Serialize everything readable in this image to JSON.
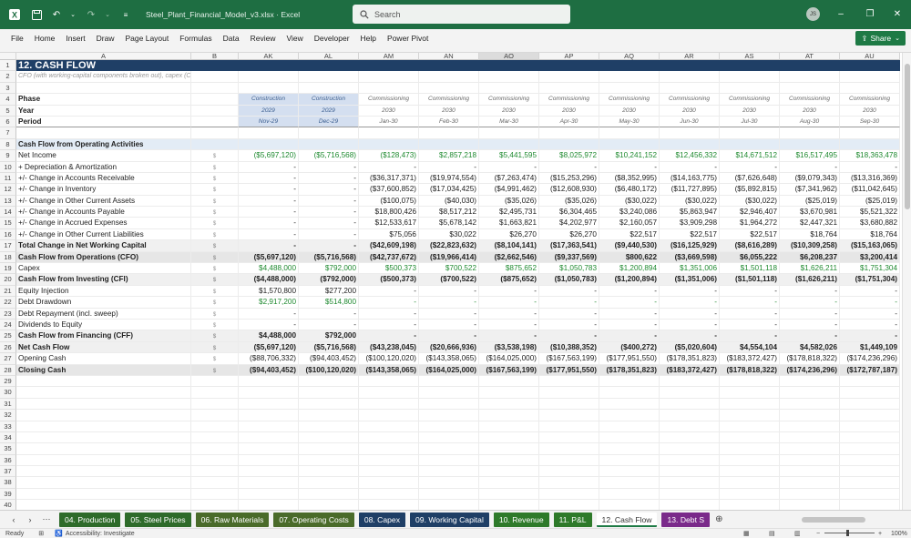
{
  "window": {
    "file_name": "Steel_Plant_Financial_Model_v3.xlsx",
    "app_name": "Excel",
    "search_placeholder": "Search",
    "user_initials": "JS",
    "theme_color": "#1e6e42"
  },
  "menu": [
    "File",
    "Home",
    "Insert",
    "Draw",
    "Page Layout",
    "Formulas",
    "Data",
    "Review",
    "View",
    "Developer",
    "Help",
    "Power Pivot"
  ],
  "share_label": "Share",
  "columns": [
    "A",
    "B",
    "AK",
    "AL",
    "AM",
    "AN",
    "AO",
    "AP",
    "AQ",
    "AR",
    "AS",
    "AT",
    "AU"
  ],
  "selected_column": "AO",
  "rows": [
    {
      "n": "1",
      "type": "title",
      "label": "12. CASH FLOW",
      "values": []
    },
    {
      "n": "2",
      "type": "sub",
      "label": "CFO (with working-capital components broken out), capex (CFI), financ",
      "values": []
    },
    {
      "n": "3",
      "type": "blank",
      "label": "",
      "values": []
    },
    {
      "n": "4",
      "type": "hdr",
      "label": "Phase",
      "values": [
        "Construction",
        "Construction",
        "Commissioning",
        "Commissioning",
        "Commissioning",
        "Commissioning",
        "Commissioning",
        "Commissioning",
        "Commissioning",
        "Commissioning",
        "Commissioning"
      ]
    },
    {
      "n": "5",
      "type": "hdr",
      "label": "Year",
      "values": [
        "2029",
        "2029",
        "2030",
        "2030",
        "2030",
        "2030",
        "2030",
        "2030",
        "2030",
        "2030",
        "2030"
      ]
    },
    {
      "n": "6",
      "type": "hdr",
      "label": "Period",
      "values": [
        "Nov-29",
        "Dec-29",
        "Jan-30",
        "Feb-30",
        "Mar-30",
        "Apr-30",
        "May-30",
        "Jun-30",
        "Jul-30",
        "Aug-30",
        "Sep-30"
      ]
    },
    {
      "n": "7",
      "type": "blank",
      "label": "",
      "values": []
    },
    {
      "n": "8",
      "type": "section",
      "label": "Cash Flow from Operating Activities",
      "values": []
    },
    {
      "n": "9",
      "type": "data",
      "label": "Net Income",
      "unit": "$",
      "green": true,
      "values": [
        "($5,697,120)",
        "($5,716,568)",
        "($128,473)",
        "$2,857,218",
        "$5,441,595",
        "$8,025,972",
        "$10,241,152",
        "$12,456,332",
        "$14,671,512",
        "$16,517,495",
        "$18,363,478"
      ]
    },
    {
      "n": "10",
      "type": "data",
      "label": "+ Depreciation & Amortization",
      "unit": "$",
      "values": [
        "-",
        "-",
        "-",
        "-",
        "-",
        "-",
        "-",
        "-",
        "-",
        "-",
        "-"
      ]
    },
    {
      "n": "11",
      "type": "data",
      "label": "+/- Change in Accounts Receivable",
      "unit": "$",
      "values": [
        "-",
        "-",
        "($36,317,371)",
        "($19,974,554)",
        "($7,263,474)",
        "($15,253,296)",
        "($8,352,995)",
        "($14,163,775)",
        "($7,626,648)",
        "($9,079,343)",
        "($13,316,369)"
      ]
    },
    {
      "n": "12",
      "type": "data",
      "label": "+/- Change in Inventory",
      "unit": "$",
      "values": [
        "-",
        "-",
        "($37,600,852)",
        "($17,034,425)",
        "($4,991,462)",
        "($12,608,930)",
        "($6,480,172)",
        "($11,727,895)",
        "($5,892,815)",
        "($7,341,962)",
        "($11,042,645)"
      ]
    },
    {
      "n": "13",
      "type": "data",
      "label": "+/- Change in Other Current Assets",
      "unit": "$",
      "values": [
        "-",
        "-",
        "($100,075)",
        "($40,030)",
        "($35,026)",
        "($35,026)",
        "($30,022)",
        "($30,022)",
        "($30,022)",
        "($25,019)",
        "($25,019)"
      ]
    },
    {
      "n": "14",
      "type": "data",
      "label": "+/- Change in Accounts Payable",
      "unit": "$",
      "values": [
        "-",
        "-",
        "$18,800,426",
        "$8,517,212",
        "$2,495,731",
        "$6,304,465",
        "$3,240,086",
        "$5,863,947",
        "$2,946,407",
        "$3,670,981",
        "$5,521,322"
      ]
    },
    {
      "n": "15",
      "type": "data",
      "label": "+/- Change in Accrued Expenses",
      "unit": "$",
      "values": [
        "-",
        "-",
        "$12,533,617",
        "$5,678,142",
        "$1,663,821",
        "$4,202,977",
        "$2,160,057",
        "$3,909,298",
        "$1,964,272",
        "$2,447,321",
        "$3,680,882"
      ]
    },
    {
      "n": "16",
      "type": "data",
      "label": "+/- Change in Other Current Liabilities",
      "unit": "$",
      "values": [
        "-",
        "-",
        "$75,056",
        "$30,022",
        "$26,270",
        "$26,270",
        "$22,517",
        "$22,517",
        "$22,517",
        "$18,764",
        "$18,764"
      ]
    },
    {
      "n": "17",
      "type": "bold",
      "label": "Total Change in Net Working Capital",
      "unit": "$",
      "values": [
        "-",
        "-",
        "($42,609,198)",
        "($22,823,632)",
        "($8,104,141)",
        "($17,363,541)",
        "($9,440,530)",
        "($16,125,929)",
        "($8,616,289)",
        "($10,309,258)",
        "($15,163,065)"
      ]
    },
    {
      "n": "18",
      "type": "bold",
      "label": "Cash Flow from Operations (CFO)",
      "unit": "$",
      "values": [
        "($5,697,120)",
        "($5,716,568)",
        "($42,737,672)",
        "($19,966,414)",
        "($2,662,546)",
        "($9,337,569)",
        "$800,622",
        "($3,669,598)",
        "$6,055,222",
        "$6,208,237",
        "$3,200,414"
      ]
    },
    {
      "n": "19",
      "type": "data",
      "label": "Capex",
      "unit": "$",
      "green": true,
      "values": [
        "$4,488,000",
        "$792,000",
        "$500,373",
        "$700,522",
        "$875,652",
        "$1,050,783",
        "$1,200,894",
        "$1,351,006",
        "$1,501,118",
        "$1,626,211",
        "$1,751,304"
      ]
    },
    {
      "n": "20",
      "type": "bold",
      "label": "Cash Flow from Investing (CFI)",
      "unit": "$",
      "values": [
        "($4,488,000)",
        "($792,000)",
        "($500,373)",
        "($700,522)",
        "($875,652)",
        "($1,050,783)",
        "($1,200,894)",
        "($1,351,006)",
        "($1,501,118)",
        "($1,626,211)",
        "($1,751,304)"
      ]
    },
    {
      "n": "21",
      "type": "data",
      "label": "Equity Injection",
      "unit": "$",
      "values": [
        "$1,570,800",
        "$277,200",
        "-",
        "-",
        "-",
        "-",
        "-",
        "-",
        "-",
        "-",
        "-"
      ]
    },
    {
      "n": "22",
      "type": "data",
      "label": "Debt Drawdown",
      "unit": "$",
      "green": true,
      "values": [
        "$2,917,200",
        "$514,800",
        "-",
        "-",
        "-",
        "-",
        "-",
        "-",
        "-",
        "-",
        "-"
      ]
    },
    {
      "n": "23",
      "type": "data",
      "label": "Debt Repayment (incl. sweep)",
      "unit": "$",
      "values": [
        "-",
        "-",
        "-",
        "-",
        "-",
        "-",
        "-",
        "-",
        "-",
        "-",
        "-"
      ]
    },
    {
      "n": "24",
      "type": "data",
      "label": "Dividends to Equity",
      "unit": "$",
      "values": [
        "-",
        "-",
        "-",
        "-",
        "-",
        "-",
        "-",
        "-",
        "-",
        "-",
        "-"
      ]
    },
    {
      "n": "25",
      "type": "bold",
      "label": "Cash Flow from Financing (CFF)",
      "unit": "$",
      "values": [
        "$4,488,000",
        "$792,000",
        "-",
        "-",
        "-",
        "-",
        "-",
        "-",
        "-",
        "-",
        "-"
      ]
    },
    {
      "n": "26",
      "type": "bold",
      "label": "Net Cash Flow",
      "unit": "$",
      "values": [
        "($5,697,120)",
        "($5,716,568)",
        "($43,238,045)",
        "($20,666,936)",
        "($3,538,198)",
        "($10,388,352)",
        "($400,272)",
        "($5,020,604)",
        "$4,554,104",
        "$4,582,026",
        "$1,449,109"
      ]
    },
    {
      "n": "27",
      "type": "data",
      "label": "Opening Cash",
      "unit": "$",
      "values": [
        "($88,706,332)",
        "($94,403,452)",
        "($100,120,020)",
        "($143,358,065)",
        "($164,025,000)",
        "($167,563,199)",
        "($177,951,550)",
        "($178,351,823)",
        "($183,372,427)",
        "($178,818,322)",
        "($174,236,296)"
      ]
    },
    {
      "n": "28",
      "type": "bold",
      "label": "Closing Cash",
      "unit": "$",
      "values": [
        "($94,403,452)",
        "($100,120,020)",
        "($143,358,065)",
        "($164,025,000)",
        "($167,563,199)",
        "($177,951,550)",
        "($178,351,823)",
        "($183,372,427)",
        "($178,818,322)",
        "($174,236,296)",
        "($172,787,187)"
      ]
    },
    {
      "n": "29",
      "type": "blank",
      "label": "",
      "values": []
    },
    {
      "n": "30",
      "type": "blank",
      "label": "",
      "values": []
    },
    {
      "n": "31",
      "type": "blank",
      "label": "",
      "values": []
    },
    {
      "n": "32",
      "type": "blank",
      "label": "",
      "values": []
    },
    {
      "n": "33",
      "type": "blank",
      "label": "",
      "values": []
    },
    {
      "n": "34",
      "type": "blank",
      "label": "",
      "values": []
    },
    {
      "n": "35",
      "type": "blank",
      "label": "",
      "values": []
    },
    {
      "n": "36",
      "type": "blank",
      "label": "",
      "values": []
    },
    {
      "n": "37",
      "type": "blank",
      "label": "",
      "values": []
    },
    {
      "n": "38",
      "type": "blank",
      "label": "",
      "values": []
    },
    {
      "n": "39",
      "type": "blank",
      "label": "",
      "values": []
    },
    {
      "n": "40",
      "type": "blank",
      "label": "",
      "values": []
    }
  ],
  "tabs": [
    {
      "label": "04. Production",
      "color": "#2e6b2a"
    },
    {
      "label": "05. Steel Prices",
      "color": "#2e6b2a"
    },
    {
      "label": "06. Raw Materials",
      "color": "#4a6b2a"
    },
    {
      "label": "07. Operating Costs",
      "color": "#4a6b2a"
    },
    {
      "label": "08. Capex",
      "color": "#1f3f66"
    },
    {
      "label": "09. Working Capital",
      "color": "#1f3f66"
    },
    {
      "label": "10. Revenue",
      "color": "#2e7a2a"
    },
    {
      "label": "11. P&L",
      "color": "#2e7a2a"
    },
    {
      "label": "12. Cash Flow",
      "color": "#ffffff",
      "active": true
    },
    {
      "label": "13. Debt S",
      "color": "#7a2a8a"
    }
  ],
  "status": {
    "ready": "Ready",
    "accessibility": "Accessibility: Investigate",
    "zoom": "100%"
  }
}
